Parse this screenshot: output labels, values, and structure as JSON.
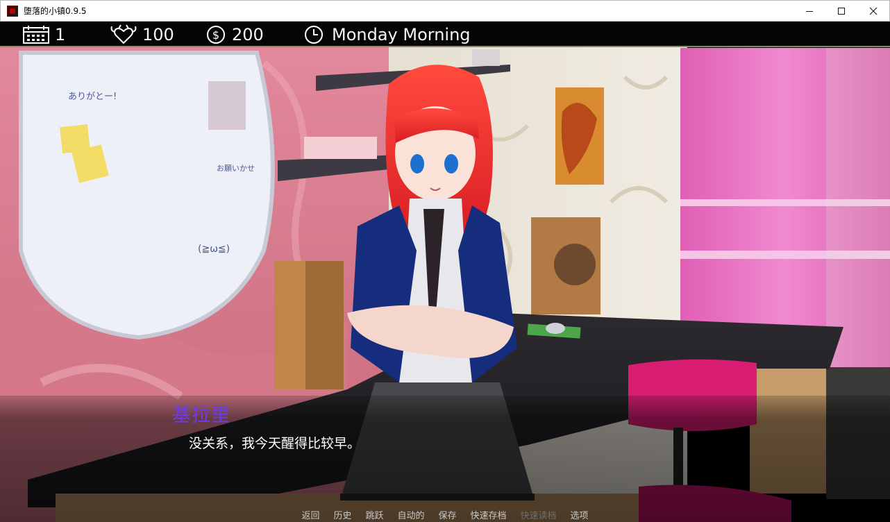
{
  "window": {
    "title": "堕落的小镇0.9.5",
    "minimize_icon": "minimize-icon",
    "maximize_icon": "maximize-icon",
    "close_icon": "close-icon"
  },
  "hud": {
    "day": {
      "icon": "calendar-icon",
      "value": "1"
    },
    "lust": {
      "icon": "demon-heart-icon",
      "value": "100"
    },
    "money": {
      "icon": "dollar-coin-icon",
      "value": "200"
    },
    "time": {
      "icon": "clock-icon",
      "value": "Monday Morning"
    }
  },
  "dialogue": {
    "speaker": "基拉里",
    "speaker_color": "#6a3cf0",
    "text": "没关系，我今天醒得比较早。"
  },
  "quick_menu": [
    {
      "label": "返回",
      "enabled": true
    },
    {
      "label": "历史",
      "enabled": true
    },
    {
      "label": "跳跃",
      "enabled": true
    },
    {
      "label": "自动的",
      "enabled": true
    },
    {
      "label": "保存",
      "enabled": true
    },
    {
      "label": "快速存档",
      "enabled": true
    },
    {
      "label": "快速读档",
      "enabled": false
    },
    {
      "label": "选项",
      "enabled": true
    }
  ],
  "scene": {
    "whiteboard_notes": [
      "ありがとー!",
      "お願いかせ",
      "(≧ω≦)"
    ]
  }
}
